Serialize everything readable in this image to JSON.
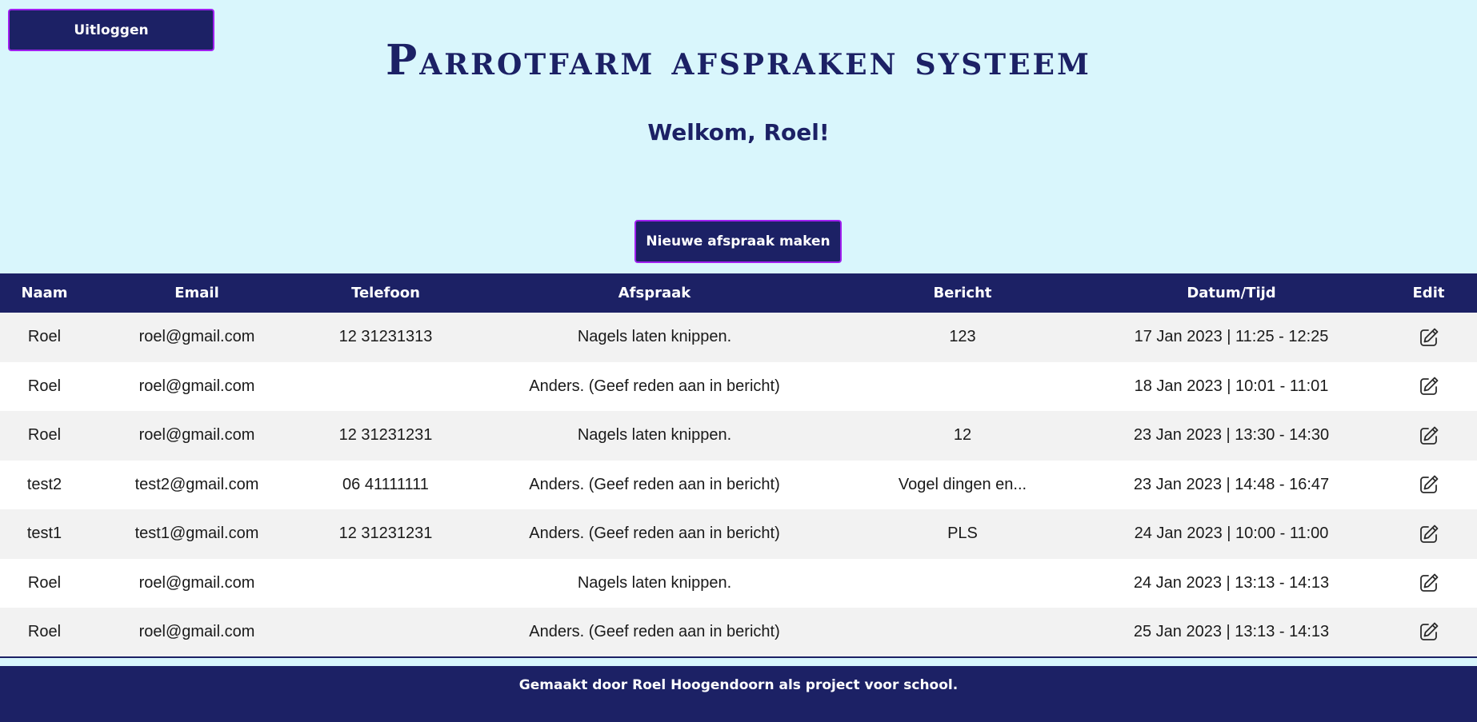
{
  "header": {
    "logout_label": "Uitloggen",
    "title": "Parrotfarm afspraken systeem",
    "welcome": "Welkom, Roel!",
    "new_appointment_label": "Nieuwe afspraak maken"
  },
  "table": {
    "columns": [
      "Naam",
      "Email",
      "Telefoon",
      "Afspraak",
      "Bericht",
      "Datum/Tijd",
      "Edit"
    ],
    "rows": [
      {
        "naam": "Roel",
        "email": "roel@gmail.com",
        "telefoon": "12 31231313",
        "afspraak": "Nagels laten knippen.",
        "bericht": "123",
        "datum_tijd": "17 Jan 2023 | 11:25 - 12:25",
        "edit_icon": "edit-icon"
      },
      {
        "naam": "Roel",
        "email": "roel@gmail.com",
        "telefoon": "",
        "afspraak": "Anders. (Geef reden aan in bericht)",
        "bericht": "",
        "datum_tijd": "18 Jan 2023 | 10:01 - 11:01",
        "edit_icon": "edit-icon"
      },
      {
        "naam": "Roel",
        "email": "roel@gmail.com",
        "telefoon": "12 31231231",
        "afspraak": "Nagels laten knippen.",
        "bericht": "12",
        "datum_tijd": "23 Jan 2023 | 13:30 - 14:30",
        "edit_icon": "edit-icon"
      },
      {
        "naam": "test2",
        "email": "test2@gmail.com",
        "telefoon": "06 41111111",
        "afspraak": "Anders. (Geef reden aan in bericht)",
        "bericht": "Vogel dingen en...",
        "datum_tijd": "23 Jan 2023 | 14:48 - 16:47",
        "edit_icon": "edit-icon"
      },
      {
        "naam": "test1",
        "email": "test1@gmail.com",
        "telefoon": "12 31231231",
        "afspraak": "Anders. (Geef reden aan in bericht)",
        "bericht": "PLS",
        "datum_tijd": "24 Jan 2023 | 10:00 - 11:00",
        "edit_icon": "edit-icon"
      },
      {
        "naam": "Roel",
        "email": "roel@gmail.com",
        "telefoon": "",
        "afspraak": "Nagels laten knippen.",
        "bericht": "",
        "datum_tijd": "24 Jan 2023 | 13:13 - 14:13",
        "edit_icon": "edit-icon"
      },
      {
        "naam": "Roel",
        "email": "roel@gmail.com",
        "telefoon": "",
        "afspraak": "Anders. (Geef reden aan in bericht)",
        "bericht": "",
        "datum_tijd": "25 Jan 2023 | 13:13 - 14:13",
        "edit_icon": "edit-icon"
      }
    ]
  },
  "footer": {
    "text": "Gemaakt door Roel Hoogendoorn als project voor school."
  },
  "colors": {
    "background": "#d9f6fc",
    "primary": "#1c2165",
    "button_border": "#a020f0",
    "row_alt": "#f2f2f2"
  }
}
